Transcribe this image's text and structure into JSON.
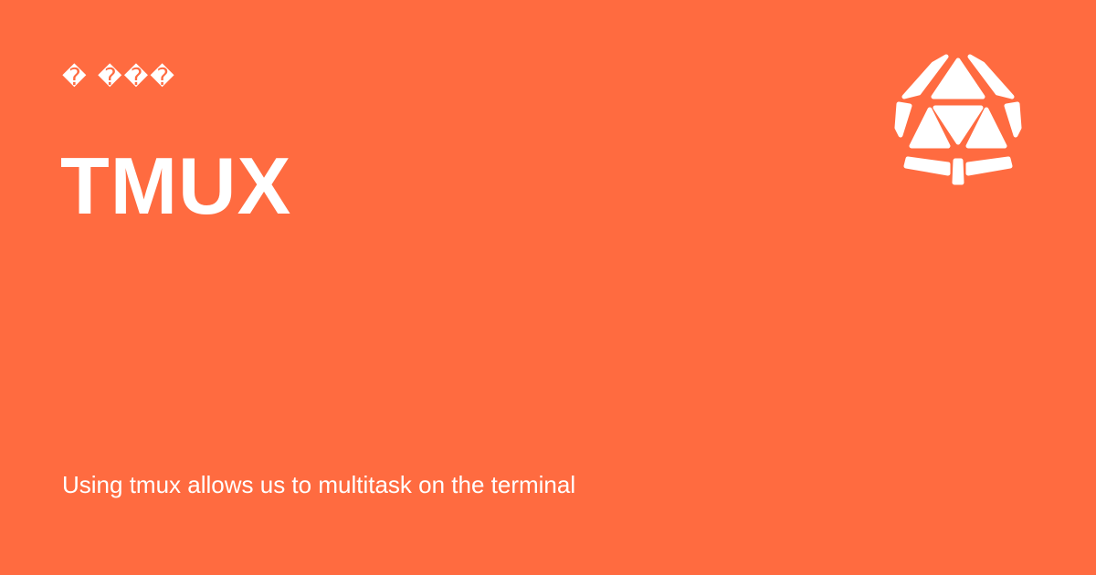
{
  "card": {
    "topline": "� ���",
    "title": "TMUX",
    "subtitle": "Using tmux allows us to multitask on the terminal"
  },
  "logo": {
    "icon": "d20-dice-icon"
  },
  "colors": {
    "background": "#ff6b40",
    "text": "#ffffff"
  }
}
